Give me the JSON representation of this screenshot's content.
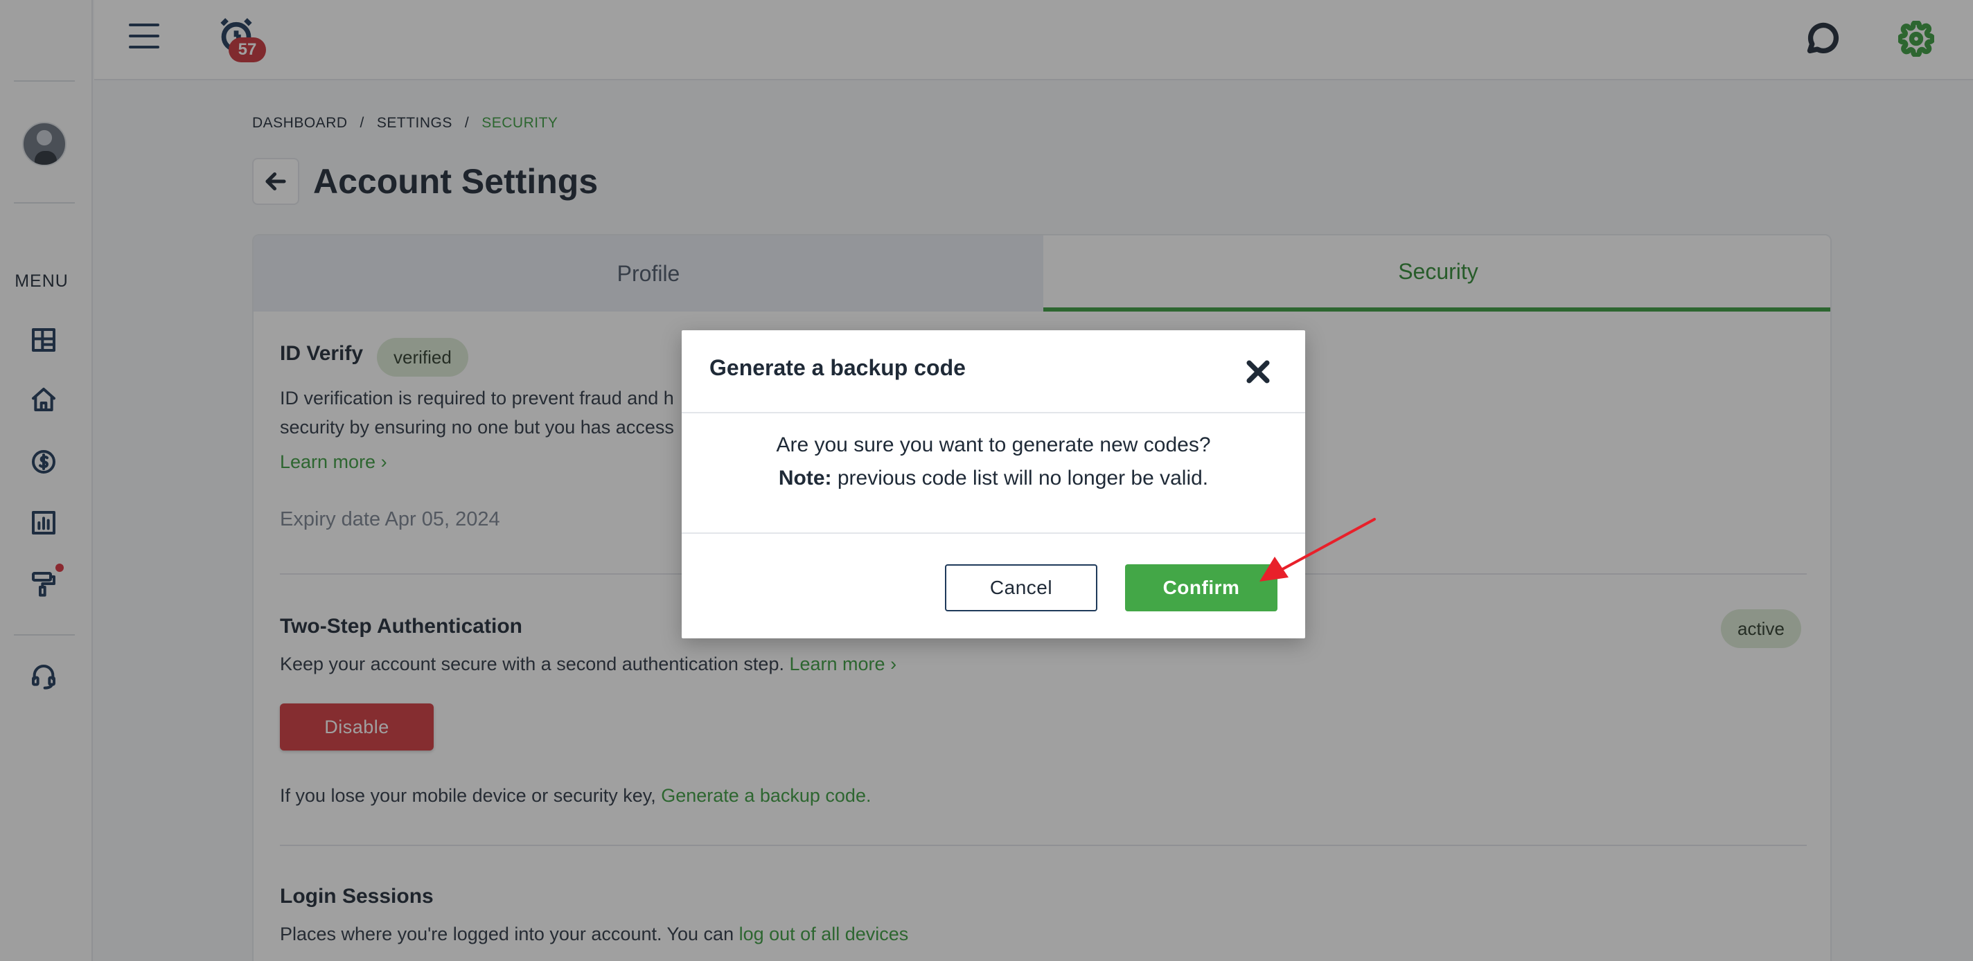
{
  "topbar": {
    "notification_count": "57"
  },
  "sidebar": {
    "menu_label": "MENU"
  },
  "breadcrumb": {
    "items": [
      "DASHBOARD",
      "SETTINGS",
      "SECURITY"
    ],
    "separator": "/"
  },
  "page": {
    "title": "Account Settings"
  },
  "tabs": [
    {
      "label": "Profile",
      "active": false
    },
    {
      "label": "Security",
      "active": true
    }
  ],
  "id_verify": {
    "title": "ID Verify",
    "badge": "verified",
    "description_line1": "ID verification is required to prevent fraud and h",
    "description_line2": "security by ensuring no one but you has access",
    "learn_more": "Learn more",
    "expiry": "Expiry date Apr 05, 2024"
  },
  "two_step": {
    "title": "Two-Step Authentication",
    "badge": "active",
    "description": "Keep your account secure with a second authentication step.",
    "learn_more": "Learn more",
    "disable_label": "Disable",
    "backup_text": "If you lose your mobile device or security key,",
    "backup_link": "Generate a backup code."
  },
  "login_sessions": {
    "title": "Login Sessions",
    "description": "Places where you're logged into your account. You can",
    "logout_link": "log out of all devices"
  },
  "modal": {
    "title": "Generate a backup code",
    "question": "Are you sure you want to generate new codes?",
    "note_label": "Note:",
    "note_text": "previous code list will no longer be valid.",
    "cancel_label": "Cancel",
    "confirm_label": "Confirm"
  },
  "colors": {
    "accent_green": "#3a9b3f",
    "danger_red": "#d0393f",
    "annotation_arrow": "#e8202a"
  }
}
